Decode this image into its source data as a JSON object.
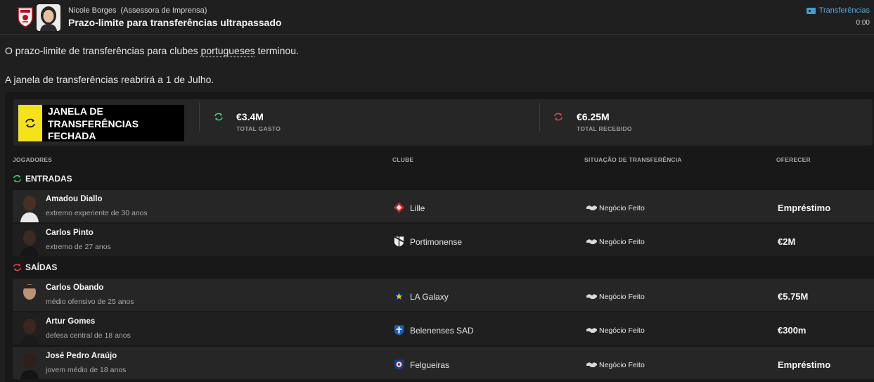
{
  "header": {
    "sender_name": "Nicole Borges",
    "sender_role": "(Assessora de Imprensa)",
    "subject": "Prazo-limite para transferências ultrapassado",
    "category": "Transferências",
    "time": "0:00"
  },
  "message": {
    "line1_before": "O prazo-limite de transferências para clubes ",
    "line1_link": "portugueses",
    "line1_after": " terminou.",
    "line2": "A janela de transferências reabrirá a 1 de Julho."
  },
  "summary": {
    "window_status": "JANELA DE TRANSFERÊNCIAS FECHADA",
    "spent_value": "€3.4M",
    "spent_label": "TOTAL GASTO",
    "received_value": "€6.25M",
    "received_label": "TOTAL RECEBIDO"
  },
  "columns": {
    "players": "JOGADORES",
    "club": "CLUBE",
    "status": "SITUAÇÃO DE TRANSFERÊNCIA",
    "offer": "OFERECER"
  },
  "incoming": {
    "title": "ENTRADAS",
    "rows": [
      {
        "name": "Amadou Diallo",
        "desc": "extremo experiente de 30 anos",
        "club": "Lille",
        "status": "Negócio Feito",
        "offer": "Empréstimo"
      },
      {
        "name": "Carlos Pinto",
        "desc": "extremo de 27 anos",
        "club": "Portimonense",
        "status": "Negócio Feito",
        "offer": "€2M"
      }
    ]
  },
  "outgoing": {
    "title": "SAÍDAS",
    "rows": [
      {
        "name": "Carlos Obando",
        "desc": "médio ofensivo de 25 anos",
        "club": "LA Galaxy",
        "status": "Negócio Feito",
        "offer": "€5.75M"
      },
      {
        "name": "Artur Gomes",
        "desc": "defesa central de 18 anos",
        "club": "Belenenses SAD",
        "status": "Negócio Feito",
        "offer": "€300m"
      },
      {
        "name": "José Pedro Araújo",
        "desc": "jovem médio de 18 anos",
        "club": "Felgueiras",
        "status": "Negócio Feito",
        "offer": "Empréstimo"
      }
    ]
  },
  "colors": {
    "accent_yellow": "#f5e21a",
    "incoming_green": "#3fcf6c",
    "outgoing_red": "#e8454a",
    "link_blue": "#5aa6d6"
  }
}
